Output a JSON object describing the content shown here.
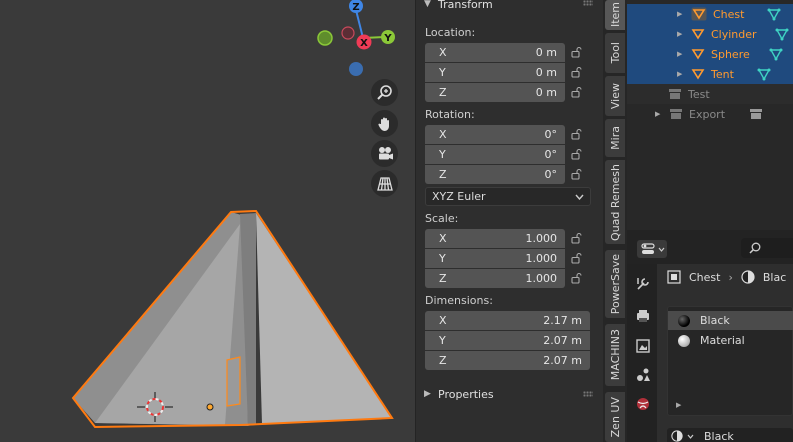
{
  "transform": {
    "title": "Transform",
    "location": {
      "label": "Location:",
      "rows": [
        {
          "axis": "X",
          "value": "0 m"
        },
        {
          "axis": "Y",
          "value": "0 m"
        },
        {
          "axis": "Z",
          "value": "0 m"
        }
      ]
    },
    "rotation": {
      "label": "Rotation:",
      "rows": [
        {
          "axis": "X",
          "value": "0°"
        },
        {
          "axis": "Y",
          "value": "0°"
        },
        {
          "axis": "Z",
          "value": "0°"
        }
      ],
      "mode": "XYZ Euler"
    },
    "scale": {
      "label": "Scale:",
      "rows": [
        {
          "axis": "X",
          "value": "1.000"
        },
        {
          "axis": "Y",
          "value": "1.000"
        },
        {
          "axis": "Z",
          "value": "1.000"
        }
      ]
    },
    "dimensions": {
      "label": "Dimensions:",
      "rows": [
        {
          "axis": "X",
          "value": "2.17 m"
        },
        {
          "axis": "Y",
          "value": "2.07 m"
        },
        {
          "axis": "Z",
          "value": "2.07 m"
        }
      ]
    }
  },
  "properties_panel": {
    "title": "Properties"
  },
  "gizmo": {
    "z": "Z",
    "x": "X",
    "y": "Y"
  },
  "tabs": [
    "Item",
    "Tool",
    "View",
    "Mira",
    "Quad Remesh",
    "PowerSave",
    "MACHIN3",
    "Zen UV"
  ],
  "outliner": {
    "objects": [
      "Chest",
      "Clyinder",
      "Sphere",
      "Tent"
    ],
    "collections": [
      "Test",
      "Export"
    ]
  },
  "editor": {
    "breadcrumb_object": "Chest",
    "breadcrumb_material": "Blac",
    "material_slots": [
      "Black",
      "Material"
    ],
    "bottom_material": "Black"
  },
  "colors": {
    "accent_selection": "#1f4a7e",
    "object_orange": "#ff9a2f",
    "axis_x": "#f03b56",
    "axis_y": "#8bc838",
    "axis_z": "#3f86e6"
  }
}
